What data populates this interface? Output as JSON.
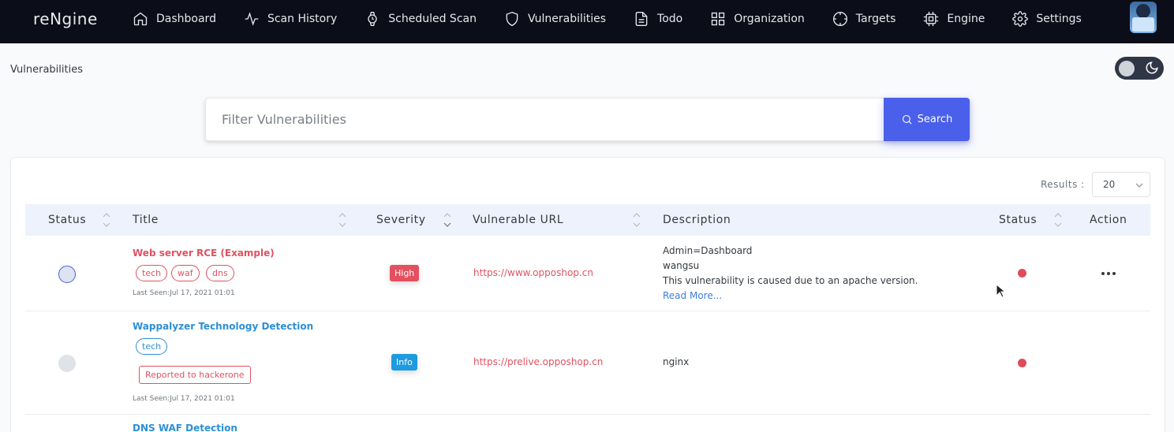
{
  "app": {
    "brand": "reNgine"
  },
  "nav": [
    {
      "label": "Dashboard",
      "icon": "home-icon"
    },
    {
      "label": "Scan History",
      "icon": "activity-icon"
    },
    {
      "label": "Scheduled Scan",
      "icon": "watch-icon"
    },
    {
      "label": "Vulnerabilities",
      "icon": "shield-icon"
    },
    {
      "label": "Todo",
      "icon": "file-text-icon"
    },
    {
      "label": "Organization",
      "icon": "grid-icon"
    },
    {
      "label": "Targets",
      "icon": "crosshair-icon"
    },
    {
      "label": "Engine",
      "icon": "cpu-icon"
    },
    {
      "label": "Settings",
      "icon": "gear-icon"
    }
  ],
  "page": {
    "title": "Vulnerabilities"
  },
  "search": {
    "placeholder": "Filter Vulnerabilities",
    "value": "",
    "button_label": "Search"
  },
  "results": {
    "label": "Results :",
    "value": "20"
  },
  "table": {
    "columns": [
      "Status",
      "Title",
      "Severity",
      "Vulnerable URL",
      "Description",
      "Status",
      "Action"
    ],
    "rows": [
      {
        "title": "Web server RCE (Example)",
        "title_color": "#e05260",
        "tags": [
          "tech",
          "waf",
          "dns"
        ],
        "last_seen": "Last Seen:Jul 17, 2021 01:01",
        "severity": "High",
        "url": "https://www.opposhop.cn",
        "description_lines": [
          "Admin=Dashboard",
          "wangsu",
          "This vulnerability is caused due to an apache version."
        ],
        "read_more": "Read More..."
      },
      {
        "title": "Wappalyzer Technology Detection",
        "title_color": "#2d8fd5",
        "tags": [
          "tech"
        ],
        "reported": "Reported to hackerone",
        "last_seen": "Last Seen:Jul 17, 2021 01:01",
        "severity": "Info",
        "url": "https://prelive.opposhop.cn",
        "description_lines": [
          "nginx"
        ]
      },
      {
        "title": "DNS WAF Detection",
        "title_color": "#2d8fd5"
      }
    ]
  },
  "colors": {
    "nav_bg": "#0b0d18",
    "accent": "#4a5fea",
    "high": "#e3505f",
    "info": "#1e9ae0",
    "danger_dot": "#e04a59"
  }
}
